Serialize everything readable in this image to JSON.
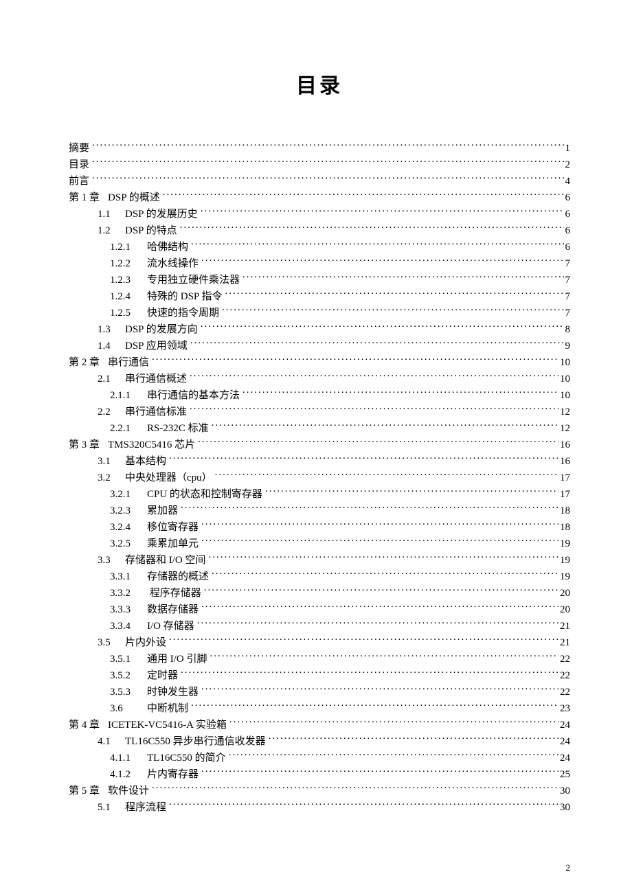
{
  "title": "目录",
  "page_number": "2",
  "entries": [
    {
      "indent": 0,
      "num": "",
      "text": "摘要",
      "page": "1"
    },
    {
      "indent": 0,
      "num": "",
      "text": "目录",
      "page": "2"
    },
    {
      "indent": 0,
      "num": "",
      "text": "前言",
      "page": "4"
    },
    {
      "indent": 0,
      "num": "第 1 章",
      "text": "DSP 的概述",
      "page": "6"
    },
    {
      "indent": 1,
      "num": "1.1",
      "text": "DSP 的发展历史",
      "page": "6"
    },
    {
      "indent": 1,
      "num": "1.2",
      "text": "DSP 的特点",
      "page": "6"
    },
    {
      "indent": 2,
      "num": "1.2.1",
      "text": "哈佛结构",
      "page": "6"
    },
    {
      "indent": 2,
      "num": "1.2.2",
      "text": "流水线操作",
      "page": "7"
    },
    {
      "indent": 2,
      "num": "1.2.3",
      "text": "专用独立硬件乘法器",
      "page": "7"
    },
    {
      "indent": 2,
      "num": "1.2.4",
      "text": "特殊的 DSP 指令",
      "page": "7"
    },
    {
      "indent": 2,
      "num": "1.2.5",
      "text": "快速的指令周期",
      "page": "7"
    },
    {
      "indent": 1,
      "num": "1.3",
      "text": "DSP 的发展方向",
      "page": "8"
    },
    {
      "indent": 1,
      "num": "1.4",
      "text": "DSP 应用领域",
      "page": "9"
    },
    {
      "indent": 0,
      "num": "第 2 章",
      "text": "串行通信",
      "page": "10"
    },
    {
      "indent": 1,
      "num": "2.1",
      "text": "串行通信概述",
      "page": "10"
    },
    {
      "indent": 2,
      "num": "2.1.1",
      "text": "串行通信的基本方法",
      "page": "10"
    },
    {
      "indent": 1,
      "num": "2.2",
      "text": "串行通信标准",
      "page": "12"
    },
    {
      "indent": 2,
      "num": "2.2.1",
      "text": "RS-232C 标准",
      "page": "12"
    },
    {
      "indent": 0,
      "num": "第 3 章",
      "text": "TMS320C5416 芯片",
      "page": "16"
    },
    {
      "indent": 1,
      "num": "3.1",
      "text": "基本结构",
      "page": "16"
    },
    {
      "indent": 1,
      "num": "3.2",
      "text": "中央处理器（cpu）",
      "page": "17"
    },
    {
      "indent": 2,
      "num": "3.2.1",
      "text": "CPU 的状态和控制寄存器",
      "page": "17"
    },
    {
      "indent": 2,
      "num": "3.2.3",
      "text": "累加器",
      "page": "18"
    },
    {
      "indent": 2,
      "num": "3.2.4",
      "text": "移位寄存器",
      "page": "18"
    },
    {
      "indent": 2,
      "num": "3.2.5",
      "text": "乘累加单元",
      "page": "19"
    },
    {
      "indent": 1,
      "num": "3.3",
      "text": "存储器和 I/O 空间",
      "page": "19"
    },
    {
      "indent": 2,
      "num": "3.3.1",
      "text": "存储器的概述",
      "page": "19"
    },
    {
      "indent": 2,
      "num": "3.3.2",
      "text": " 程序存储器",
      "page": "20"
    },
    {
      "indent": 2,
      "num": "3.3.3",
      "text": "数据存储器",
      "page": "20"
    },
    {
      "indent": 2,
      "num": "3.3.4",
      "text": "I/O 存储器",
      "page": "21"
    },
    {
      "indent": 1,
      "num": "3.5",
      "text": "片内外设",
      "page": "21"
    },
    {
      "indent": 2,
      "num": "3.5.1",
      "text": "通用 I/O 引脚",
      "page": "22"
    },
    {
      "indent": 2,
      "num": "3.5.2",
      "text": "定时器",
      "page": "22"
    },
    {
      "indent": 2,
      "num": "3.5.3",
      "text": "时钟发生器",
      "page": "22"
    },
    {
      "indent": 2,
      "num": "3.6",
      "text": "中断机制",
      "page": "23"
    },
    {
      "indent": 0,
      "num": "第 4 章",
      "text": "ICETEK-VC5416-A 实验箱",
      "page": "24"
    },
    {
      "indent": 1,
      "num": "4.1",
      "text": "TL16C550  异步串行通信收发器",
      "page": "24"
    },
    {
      "indent": 2,
      "num": "4.1.1",
      "text": "TL16C550 的简介",
      "page": "24"
    },
    {
      "indent": 2,
      "num": "4.1.2",
      "text": "片内寄存器",
      "page": "25"
    },
    {
      "indent": 0,
      "num": "第 5 章",
      "text": "软件设计",
      "page": "30"
    },
    {
      "indent": 1,
      "num": "5.1",
      "text": "程序流程",
      "page": "30"
    }
  ]
}
